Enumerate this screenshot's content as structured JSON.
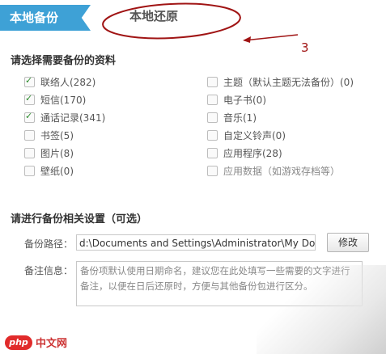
{
  "tabs": {
    "local_backup": "本地备份",
    "local_restore": "本地还原"
  },
  "annotation": {
    "number": "3"
  },
  "select_section": {
    "title": "请选择需要备份的资料",
    "left_items": [
      {
        "label": "联络人(282)",
        "checked": true
      },
      {
        "label": "短信(170)",
        "checked": true
      },
      {
        "label": "通话记录(341)",
        "checked": true
      },
      {
        "label": "书签(5)",
        "checked": false
      },
      {
        "label": "图片(8)",
        "checked": false
      },
      {
        "label": "壁纸(0)",
        "checked": false
      }
    ],
    "right_items": [
      {
        "label": "主题（默认主题无法备份）(0)",
        "checked": false
      },
      {
        "label": "电子书(0)",
        "checked": false
      },
      {
        "label": "音乐(1)",
        "checked": false
      },
      {
        "label": "自定义铃声(0)",
        "checked": false
      },
      {
        "label": "应用程序(28)",
        "checked": false
      },
      {
        "label": "应用数据（如游戏存档等）",
        "checked": false
      }
    ]
  },
  "settings_section": {
    "title": "请进行备份相关设置（可选）",
    "path_label": "备份路径：",
    "path_value": "d:\\Documents and Settings\\Administrator\\My Doc",
    "modify_button": "修改",
    "note_label": "备注信息：",
    "note_placeholder": "备份项默认使用日期命名，建议您在此处填写一些需要的文字进行备注，以便在日后还原时，方便与其他备份包进行区分。"
  },
  "watermark": {
    "logo": "php",
    "text": "中文网"
  },
  "colors": {
    "tab_active": "#3ea1d6",
    "annotation": "#a01414"
  }
}
